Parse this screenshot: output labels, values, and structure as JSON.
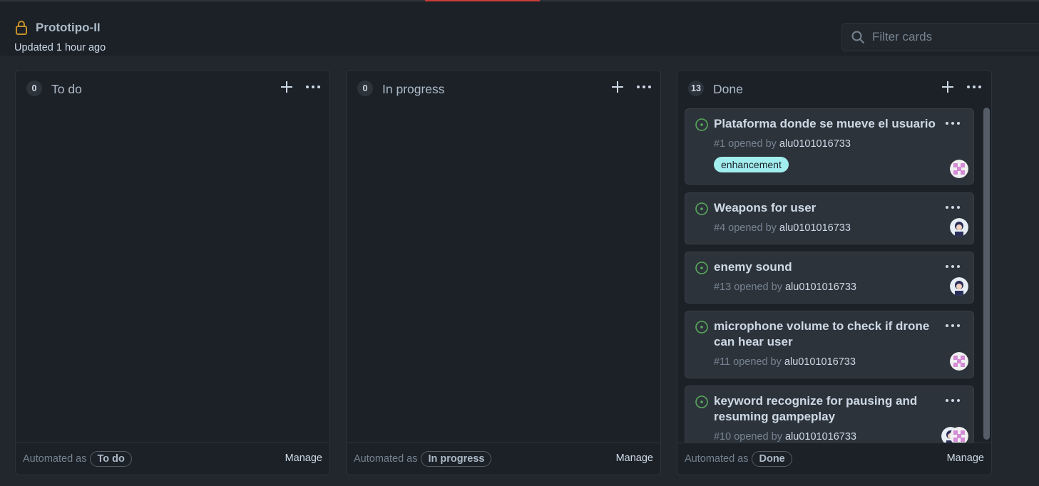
{
  "project": {
    "title": "Prototipo-II",
    "updated": "Updated 1 hour ago"
  },
  "filter": {
    "placeholder": "Filter cards"
  },
  "columns": [
    {
      "title": "To do",
      "count": "0",
      "automated_prefix": "Automated as",
      "automated_label": "To do",
      "manage": "Manage"
    },
    {
      "title": "In progress",
      "count": "0",
      "automated_prefix": "Automated as",
      "automated_label": "In progress",
      "manage": "Manage"
    },
    {
      "title": "Done",
      "count": "13",
      "automated_prefix": "Automated as",
      "automated_label": "Done",
      "manage": "Manage"
    }
  ],
  "cards": [
    {
      "title": "Plataforma donde se mueve el usuario",
      "meta": "#1 opened by ",
      "user": "alu0101016733",
      "label": "enhancement"
    },
    {
      "title": "Weapons for user",
      "meta": "#4 opened by ",
      "user": "alu0101016733"
    },
    {
      "title": "enemy sound",
      "meta": "#13 opened by ",
      "user": "alu0101016733"
    },
    {
      "title": "microphone volume to check if drone can hear user",
      "meta": "#11 opened by ",
      "user": "alu0101016733"
    },
    {
      "title": "keyword recognize for pausing and resuming gampeplay",
      "meta": "#10 opened by ",
      "user": "alu0101016733"
    }
  ],
  "colors": {
    "background": "#22272e",
    "column": "#1c2128",
    "card": "#2d333b",
    "open_issue": "#57ab5a",
    "lock": "#c69026",
    "label_enhancement": "#a2eeef",
    "active_tab": "#c93c37"
  },
  "icons": {
    "lock": "lock-icon",
    "search": "search-icon",
    "add": "plus-icon",
    "more": "kebab-horizontal-icon",
    "issue": "issue-opened-icon"
  }
}
